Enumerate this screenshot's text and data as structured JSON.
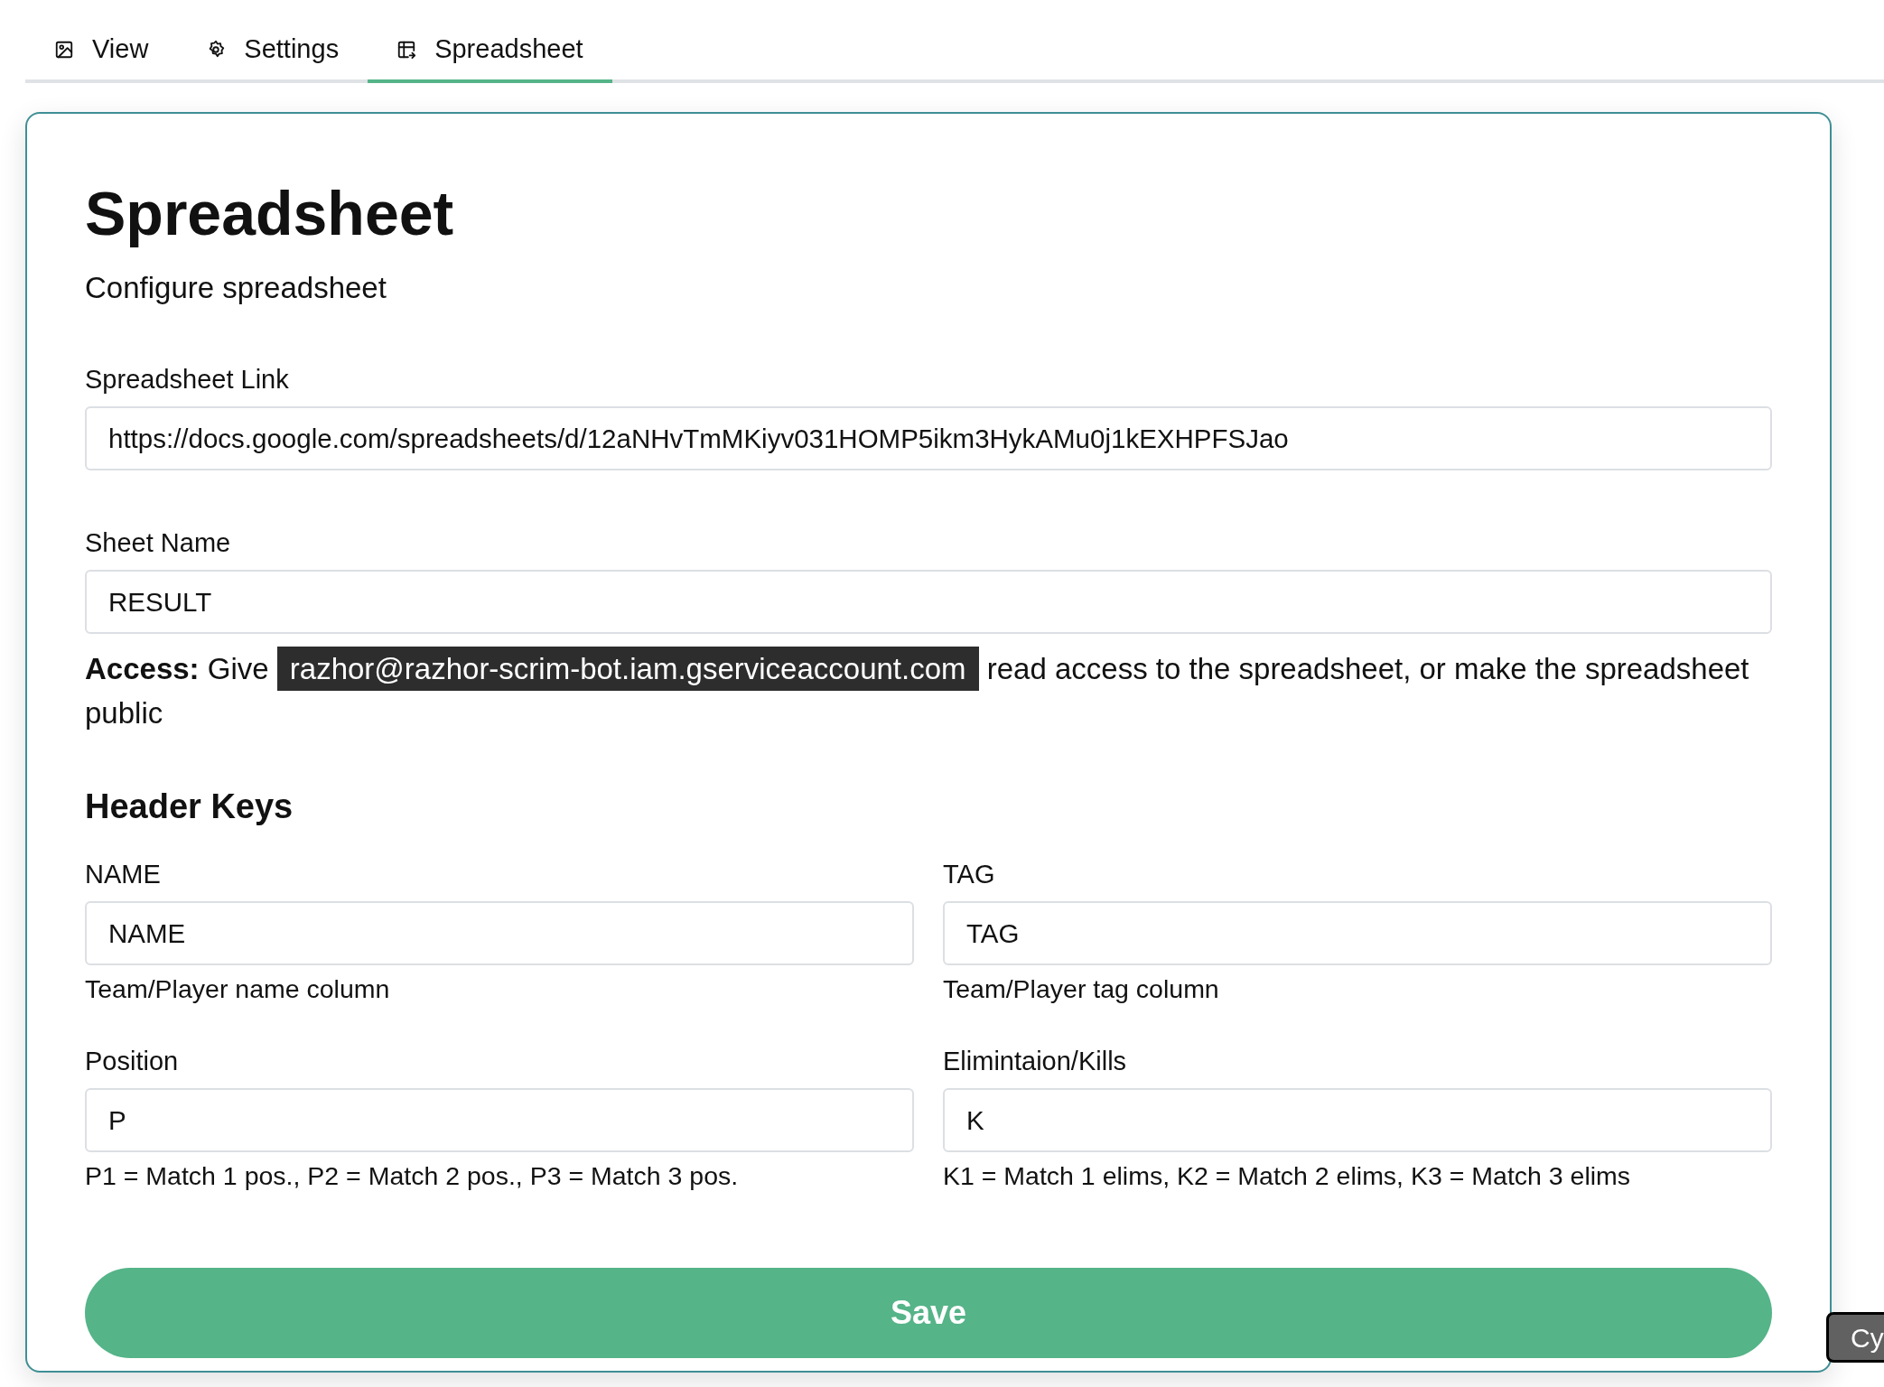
{
  "tabs": [
    {
      "label": "View",
      "selected": false
    },
    {
      "label": "Settings",
      "selected": false
    },
    {
      "label": "Spreadsheet",
      "selected": true
    }
  ],
  "card": {
    "title": "Spreadsheet",
    "subtitle": "Configure spreadsheet",
    "link_field": {
      "label": "Spreadsheet Link",
      "value": "https://docs.google.com/spreadsheets/d/12aNHvTmMKiyv031HOMP5ikm3HykAMu0j1kEXHPFSJao"
    },
    "sheet_field": {
      "label": "Sheet Name",
      "value": "RESULT"
    },
    "access": {
      "label": "Access:",
      "before": "Give",
      "email": "razhor@razhor-scrim-bot.iam.gserviceaccount.com",
      "after": "read access to the spreadsheet, or make the spreadsheet public"
    },
    "header_keys": {
      "title": "Header Keys",
      "fields": [
        {
          "label": "NAME",
          "value": "NAME",
          "help": "Team/Player name column"
        },
        {
          "label": "TAG",
          "value": "TAG",
          "help": "Team/Player tag column"
        },
        {
          "label": "Position",
          "value": "P",
          "help": "P1 = Match 1 pos., P2 = Match 2 pos., P3 = Match 3 pos."
        },
        {
          "label": "Elimintaion/Kills",
          "value": "K",
          "help": "K1 = Match 1 elims, K2 = Match 2 elims, K3 = Match 3 elims"
        }
      ]
    },
    "save_button": "Save"
  },
  "overlay_button": "Cy"
}
